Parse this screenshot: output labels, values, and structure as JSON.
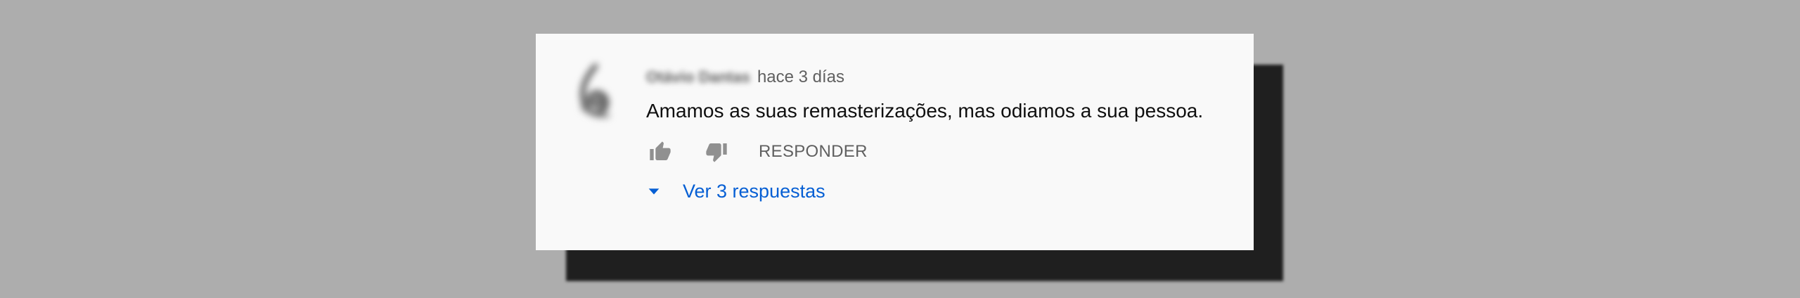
{
  "comment": {
    "author": "Otávio Dantas",
    "time": "hace 3 días",
    "text": "Amamos as suas remasterizações, mas odiamos a sua pessoa.",
    "reply_label": "RESPONDER",
    "view_replies_label": "Ver 3 respuestas"
  },
  "icons": {
    "like": "thumbs-up-icon",
    "dislike": "thumbs-down-icon",
    "expand": "caret-down-icon",
    "avatar": "avatar"
  },
  "colors": {
    "background": "#adadad",
    "card": "#f9f9f9",
    "shadow": "#1f1f1f",
    "link": "#065fd4",
    "secondary_text": "#606060",
    "primary_text": "#0f0f0f"
  }
}
